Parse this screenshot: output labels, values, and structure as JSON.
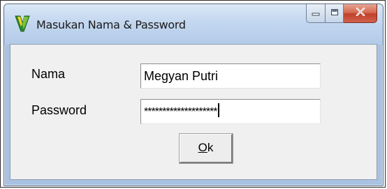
{
  "window": {
    "title": "Masukan Nama & Password",
    "icon": "app-icon"
  },
  "caption_buttons": {
    "minimize_icon": "minimize-icon",
    "maximize_icon": "maximize-icon",
    "close_icon": "close-icon"
  },
  "form": {
    "nama_label": "Nama",
    "nama_value": "Megyan Putri",
    "password_label": "Password",
    "password_value": "********************"
  },
  "ok_button": {
    "mnemonic": "O",
    "rest": "k"
  },
  "colors": {
    "close_button": "#c9523c",
    "titlebar": "#c3d7ef",
    "client": "#f0f0f0"
  }
}
